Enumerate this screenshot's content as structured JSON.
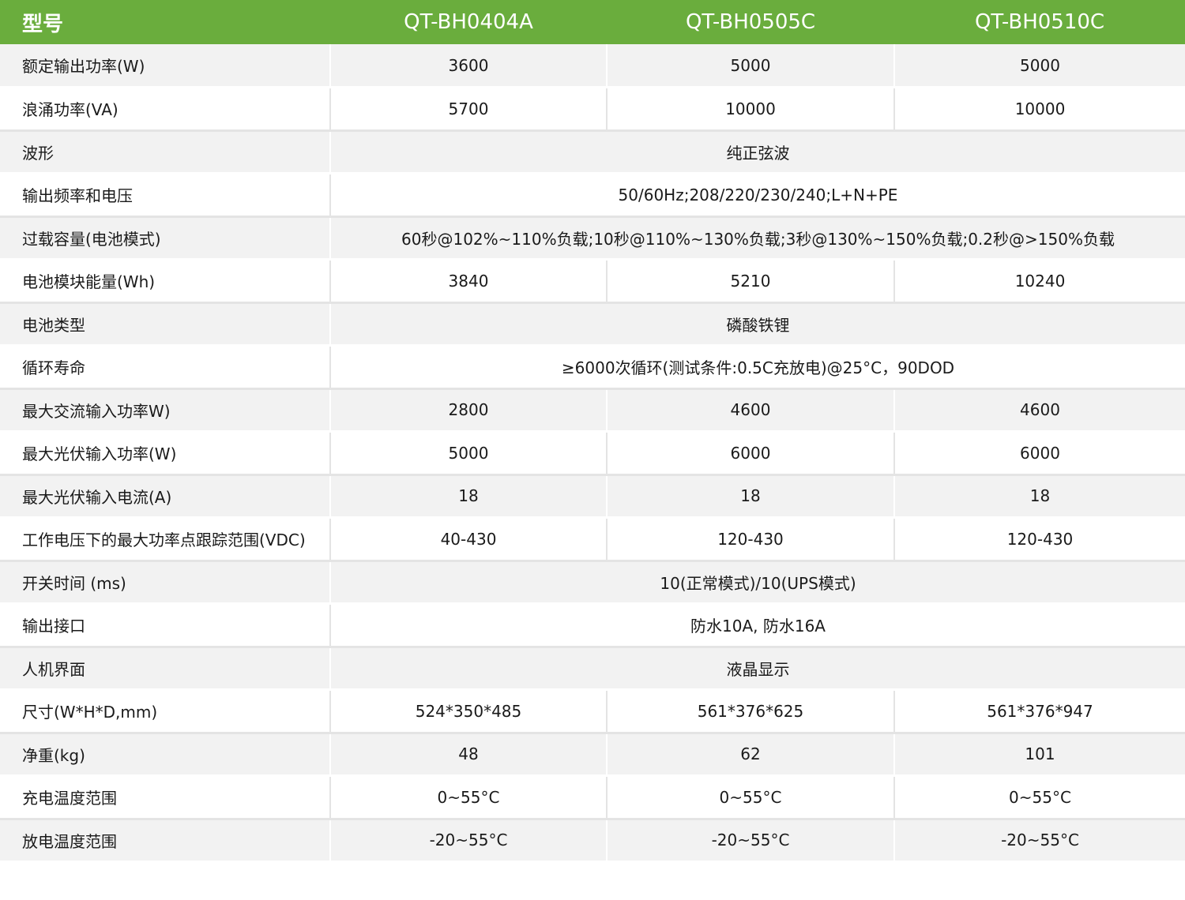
{
  "header": {
    "label": "型号",
    "models": [
      "QT-BH0404A",
      "QT-BH0505C",
      "QT-BH0510C"
    ]
  },
  "rows": [
    {
      "label": "额定输出功率(W)",
      "values": [
        "3600",
        "5000",
        "5000"
      ]
    },
    {
      "label": "浪涌功率(VA)",
      "values": [
        "5700",
        "10000",
        "10000"
      ]
    },
    {
      "label": "波形",
      "span": "纯正弦波"
    },
    {
      "label": "输出频率和电压",
      "span": "50/60Hz;208/220/230/240;L+N+PE"
    },
    {
      "label": "过载容量(电池模式)",
      "span": "60秒@102%~110%负载;10秒@110%~130%负载;3秒@130%~150%负载;0.2秒@>150%负载"
    },
    {
      "label": "电池模块能量(Wh)",
      "values": [
        "3840",
        "5210",
        "10240"
      ]
    },
    {
      "label": "电池类型",
      "span": "磷酸铁锂"
    },
    {
      "label": "循环寿命",
      "span": "≥6000次循环(测试条件:0.5C充放电)@25°C，90DOD"
    },
    {
      "label": "最大交流输入功率W)",
      "values": [
        "2800",
        "4600",
        "4600"
      ]
    },
    {
      "label": "最大光伏输入功率(W)",
      "values": [
        "5000",
        "6000",
        "6000"
      ]
    },
    {
      "label": "最大光伏输入电流(A)",
      "values": [
        "18",
        "18",
        "18"
      ]
    },
    {
      "label": "工作电压下的最大功率点跟踪范围(VDC)",
      "values": [
        "40-430",
        "120-430",
        "120-430"
      ]
    },
    {
      "label": "开关时间 (ms)",
      "span": "10(正常模式)/10(UPS模式)"
    },
    {
      "label": "输出接口",
      "span": "防水10A, 防水16A"
    },
    {
      "label": "人机界面",
      "span": "液晶显示"
    },
    {
      "label": "尺寸(W*H*D,mm)",
      "values": [
        "524*350*485",
        "561*376*625",
        "561*376*947"
      ]
    },
    {
      "label": "净重(kg)",
      "values": [
        "48",
        "62",
        "101"
      ]
    },
    {
      "label": "充电温度范围",
      "values": [
        "0~55°C",
        "0~55°C",
        "0~55°C"
      ]
    },
    {
      "label": "放电温度范围",
      "values": [
        "-20~55°C",
        "-20~55°C",
        "-20~55°C"
      ]
    }
  ],
  "colors": {
    "header_bg": "#6aad3d",
    "header_text": "#ffffff",
    "row_alt_bg": "#f2f2f2",
    "row_bg": "#ffffff"
  }
}
